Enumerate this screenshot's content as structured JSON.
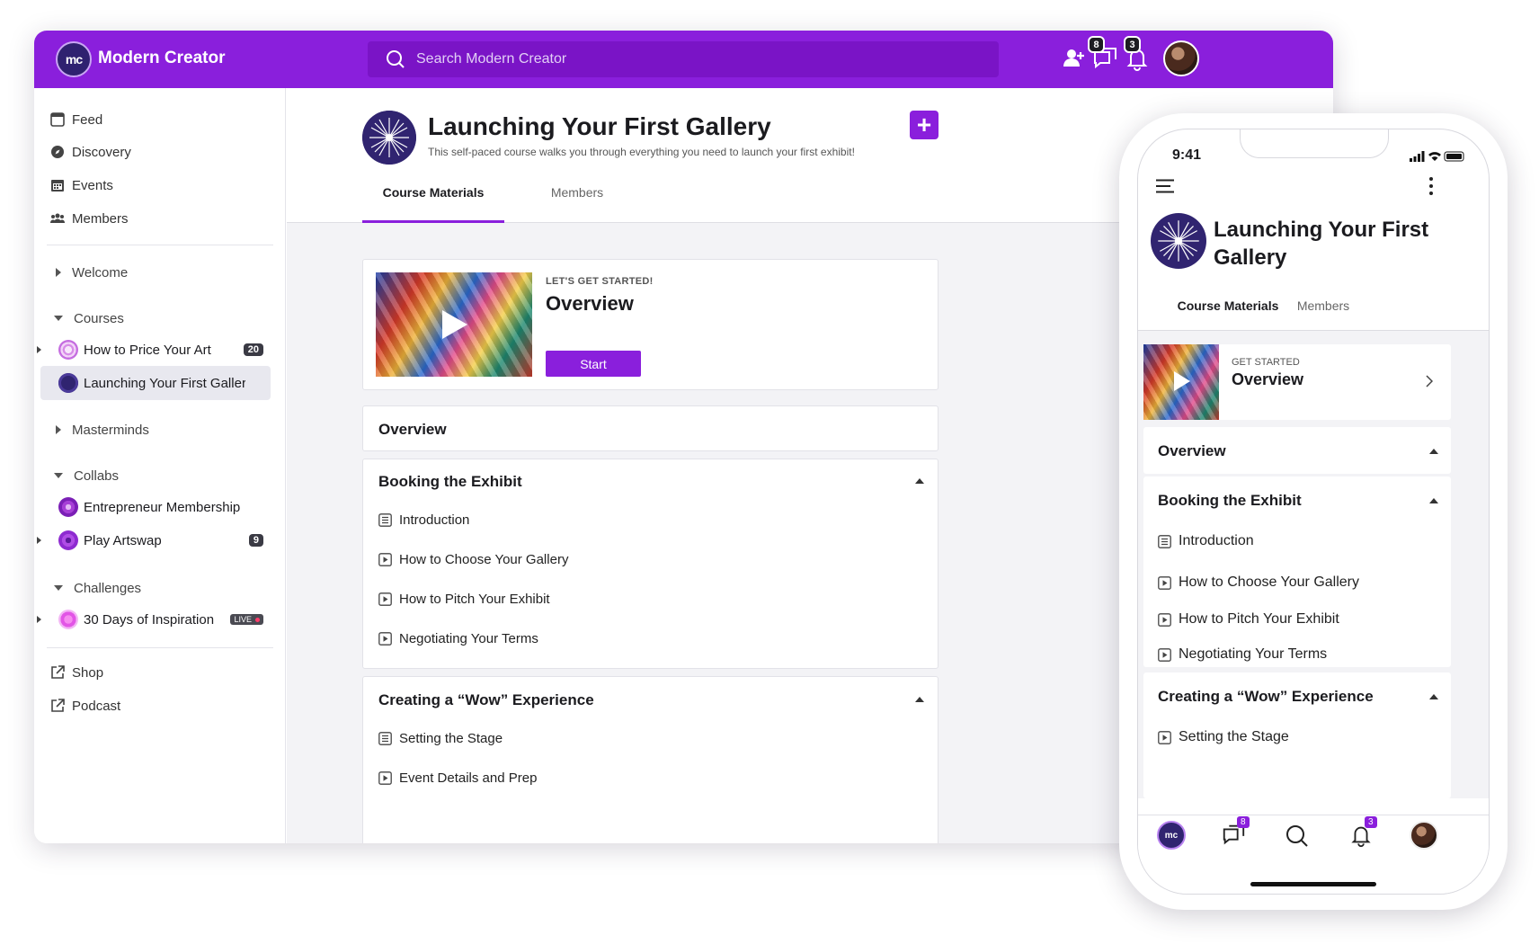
{
  "app": {
    "name": "Modern Creator",
    "logo_text": "mc"
  },
  "search": {
    "placeholder": "Search Modern Creator"
  },
  "topbar": {
    "chat_count": "8",
    "notif_count": "3"
  },
  "sidebar": {
    "nav": [
      {
        "label": "Feed",
        "icon": "feed-icon"
      },
      {
        "label": "Discovery",
        "icon": "compass-icon"
      },
      {
        "label": "Events",
        "icon": "calendar-icon"
      },
      {
        "label": "Members",
        "icon": "members-icon"
      }
    ],
    "welcome": "Welcome",
    "courses": {
      "label": "Courses",
      "items": [
        {
          "label": "How to Price Your Art",
          "count": "20"
        },
        {
          "label": "Launching Your First Gallery"
        }
      ]
    },
    "masterminds": "Masterminds",
    "collabs": {
      "label": "Collabs",
      "items": [
        {
          "label": "Entrepreneur Membership"
        },
        {
          "label": "Play Artswap",
          "count": "9"
        }
      ]
    },
    "challenges": {
      "label": "Challenges",
      "items": [
        {
          "label": "30 Days of Inspiration",
          "live": "LIVE"
        }
      ]
    },
    "links": [
      {
        "label": "Shop"
      },
      {
        "label": "Podcast"
      }
    ]
  },
  "course": {
    "title": "Launching Your First Gallery",
    "description": "This self-paced course walks you through everything you need to launch your first exhibit!",
    "tabs": [
      "Course Materials",
      "Members"
    ]
  },
  "hero": {
    "kicker": "LET'S GET STARTED!",
    "title": "Overview",
    "button": "Start"
  },
  "sections": {
    "overview": "Overview",
    "booking": {
      "title": "Booking the Exhibit",
      "lessons": [
        "Introduction",
        "How to Choose Your Gallery",
        "How to Pitch Your Exhibit",
        "Negotiating Your Terms"
      ]
    },
    "wow": {
      "title": "Creating a “Wow” Experience",
      "lessons": [
        "Setting the Stage",
        "Event Details and Prep"
      ]
    }
  },
  "phone": {
    "time": "9:41",
    "title": "Launching Your First Gallery",
    "tabs": [
      "Course Materials",
      "Members"
    ],
    "hero_kicker": "GET STARTED",
    "hero_title": "Overview",
    "chat_count": "8",
    "notif_count": "3"
  },
  "colors": {
    "brand": "#8a1fdc",
    "logo": "#302470"
  }
}
